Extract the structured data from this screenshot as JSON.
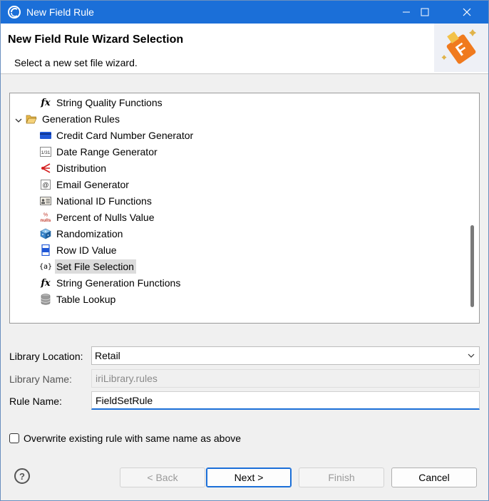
{
  "window": {
    "title": "New Field Rule",
    "colors": {
      "titlebar": "#1b6fd8",
      "accent": "#1b6fd8"
    }
  },
  "header": {
    "title": "New Field Rule Wizard Selection",
    "subtitle": "Select a new set file wizard.",
    "banner_icon": "field-rule-wizard-icon"
  },
  "tree": {
    "items": [
      {
        "label": "String Quality Functions",
        "icon": "fx-icon"
      },
      {
        "label": "Generation Rules",
        "icon": "folder-open-icon",
        "expanded": true
      },
      {
        "label": "Credit Card Number Generator",
        "icon": "credit-card-icon"
      },
      {
        "label": "Date Range Generator",
        "icon": "calendar-icon",
        "icon_text": "1/31"
      },
      {
        "label": "Distribution",
        "icon": "distribution-icon"
      },
      {
        "label": "Email Generator",
        "icon": "email-icon",
        "icon_text": "@"
      },
      {
        "label": "National ID Functions",
        "icon": "id-card-icon"
      },
      {
        "label": "Percent of Nulls Value",
        "icon": "percent-nulls-icon",
        "icon_text": "% nulls"
      },
      {
        "label": "Randomization",
        "icon": "dice-icon"
      },
      {
        "label": "Row ID Value",
        "icon": "row-id-icon"
      },
      {
        "label": "Set File Selection",
        "icon": "set-file-icon",
        "icon_text": "{a}",
        "selected": true
      },
      {
        "label": "String Generation Functions",
        "icon": "fx-icon"
      },
      {
        "label": "Table Lookup",
        "icon": "database-icon"
      }
    ]
  },
  "form": {
    "library_location": {
      "label": "Library Location:",
      "value": "Retail"
    },
    "library_name": {
      "label": "Library Name:",
      "value": "iriLibrary.rules"
    },
    "rule_name": {
      "label": "Rule Name:",
      "value": "FieldSetRule"
    },
    "overwrite": {
      "label": "Overwrite existing rule with same name as above",
      "checked": false
    }
  },
  "buttons": {
    "help": "?",
    "back": "< Back",
    "next": "Next >",
    "finish": "Finish",
    "cancel": "Cancel"
  }
}
